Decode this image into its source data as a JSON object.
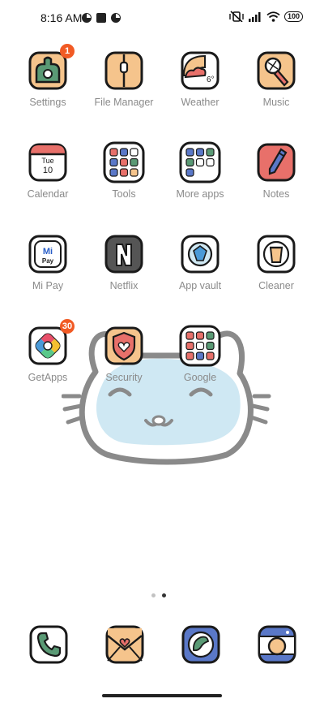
{
  "status": {
    "time": "8:16 AM",
    "battery": "100"
  },
  "apps": [
    {
      "label": "Settings",
      "badge": "1"
    },
    {
      "label": "File Manager"
    },
    {
      "label": "Weather",
      "temp": "6°"
    },
    {
      "label": "Music"
    },
    {
      "label": "Calendar",
      "day": "Tue",
      "date": "10"
    },
    {
      "label": "Tools"
    },
    {
      "label": "More apps"
    },
    {
      "label": "Notes"
    },
    {
      "label": "Mi Pay",
      "mi": "Mi",
      "pay": "Pay"
    },
    {
      "label": "Netflix"
    },
    {
      "label": "App vault"
    },
    {
      "label": "Cleaner"
    },
    {
      "label": "GetApps",
      "badge": "30"
    },
    {
      "label": "Security"
    },
    {
      "label": "Google"
    }
  ],
  "dock": [
    {
      "icon": "phone-icon"
    },
    {
      "icon": "messages-icon"
    },
    {
      "icon": "browser-icon"
    },
    {
      "icon": "camera-icon"
    }
  ],
  "page_indicator": {
    "total": 2,
    "active": 2
  },
  "colors": {
    "badge": "#f15a24",
    "label": "#8a8a8a",
    "outline": "#1a1a1a",
    "widget_fill": "#cfe8f3"
  }
}
